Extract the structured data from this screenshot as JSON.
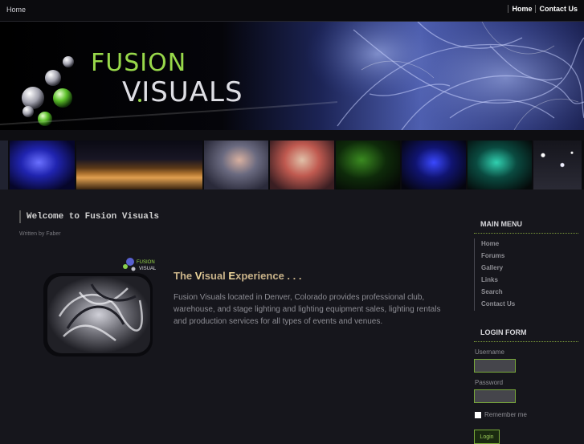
{
  "topbar": {
    "breadcrumb": "Home",
    "nav": [
      "Home",
      "Contact Us"
    ]
  },
  "banner": {
    "logo_top": "FUSION",
    "logo_bottom": "VISUALS"
  },
  "article": {
    "title": "Welcome to Fusion Visuals",
    "byline": "Written by  Faber",
    "tagline_parts": [
      "The ",
      "V",
      "isual ",
      "E",
      "xperience . . ."
    ],
    "intro": "Fusion Visuals located in Denver, Colorado provides professional club, warehouse, and stage lighting and lighting equipment sales, lighting rentals and production services for all types of events and venues."
  },
  "sidebar": {
    "main_menu_title": "MAIN MENU",
    "menu_items": [
      "Home",
      "Forums",
      "Gallery",
      "Links",
      "Search",
      "Contact Us"
    ],
    "login_title": "LOGIN FORM",
    "username_label": "Username",
    "password_label": "Password",
    "remember_label": "Remember me",
    "login_button": "Login"
  },
  "colors": {
    "accent_green": "#7aab3a",
    "tagline_gold": "#c9b389",
    "background": "#16161c"
  }
}
